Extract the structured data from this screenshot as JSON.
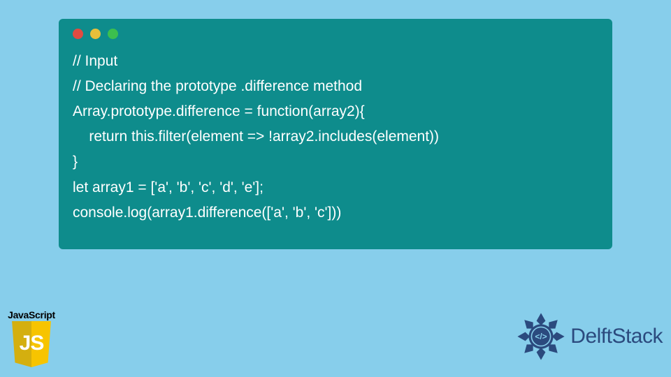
{
  "window": {
    "controls": [
      "red",
      "yellow",
      "green"
    ]
  },
  "code": {
    "lines": [
      "// Input",
      "// Declaring the prototype .difference method",
      "Array.prototype.difference = function(array2){",
      "    return this.filter(element => !array2.includes(element))",
      "}",
      "let array1 = ['a', 'b', 'c', 'd', 'e'];",
      "console.log(array1.difference(['a', 'b', 'c']))"
    ]
  },
  "js_badge": {
    "label": "JavaScript",
    "shield_text": "JS"
  },
  "delft": {
    "brand": "DelftStack"
  },
  "colors": {
    "page_bg": "#87CEEB",
    "window_bg": "#0E8C8C",
    "code_text": "#FFFFFF",
    "js_shield_left": "#D4AF0F",
    "js_shield_right": "#F7C400",
    "delft_brand": "#2B4A7E"
  }
}
